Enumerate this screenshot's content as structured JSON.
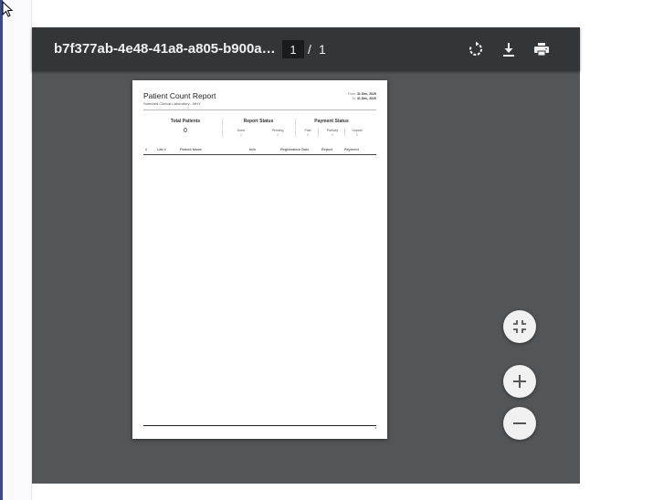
{
  "viewer": {
    "title": "b7f377ab-4e48-41a8-a805-b900ae1a...",
    "current_page": "1",
    "page_separator": "/",
    "page_count": "1"
  },
  "toolbar": {
    "rotate_icon": "rotate-icon",
    "download_icon": "download-icon",
    "print_icon": "print-icon"
  },
  "report": {
    "title": "Patient Count Report",
    "subtitle": "Standard Clinical Laboratory - MHY",
    "from_label": "From:",
    "from_date": "31 Dec, 2020",
    "to_label": "To:",
    "to_date": "31 Dec, 2020",
    "total_patients_label": "Total Patients",
    "total_patients_value": "0",
    "report_status_label": "Report Status",
    "report_status": [
      {
        "label": "Done",
        "value": "0"
      },
      {
        "label": "Pending",
        "value": "0"
      }
    ],
    "payment_status_label": "Payment Status",
    "payment_status": [
      {
        "label": "Paid",
        "value": "0"
      },
      {
        "label": "Partially",
        "value": "0"
      },
      {
        "label": "Unpaid",
        "value": "0"
      }
    ],
    "columns": [
      "#",
      "Lab #",
      "Patient Name",
      "Info",
      "Registration Date",
      "Report",
      "Payment"
    ],
    "footer_page": "1"
  },
  "controls": {
    "fit_icon": "fit-to-page-icon",
    "zoom_in_icon": "zoom-in-icon",
    "zoom_out_icon": "zoom-out-icon"
  }
}
